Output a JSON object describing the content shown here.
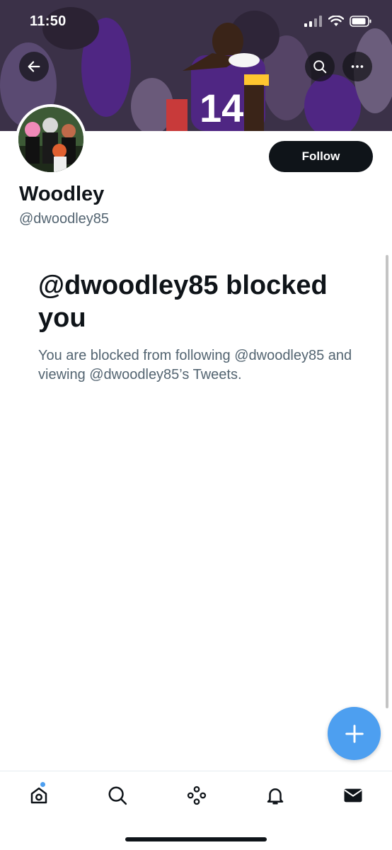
{
  "status_bar": {
    "time": "11:50"
  },
  "header": {
    "back_icon": "arrow-left-icon",
    "search_icon": "search-icon",
    "more_icon": "more-dots-icon"
  },
  "profile": {
    "display_name": "Woodley",
    "handle": "@dwoodley85",
    "follow_label": "Follow"
  },
  "blocked": {
    "title": "@dwoodley85 blocked you",
    "description": "You are blocked from following @dwoodley85 and viewing @dwoodley85’s Tweets."
  },
  "fab": {
    "icon": "plus-icon"
  },
  "tabbar": {
    "items": [
      {
        "icon": "home-icon",
        "has_notification_dot": true
      },
      {
        "icon": "search-icon"
      },
      {
        "icon": "spaces-icon"
      },
      {
        "icon": "bell-icon"
      },
      {
        "icon": "mail-icon"
      }
    ]
  },
  "colors": {
    "accent": "#4d9ff0",
    "text_primary": "#0f1419",
    "text_secondary": "#536471",
    "jersey_purple": "#4f2683",
    "jersey_gold": "#ffc62f"
  }
}
